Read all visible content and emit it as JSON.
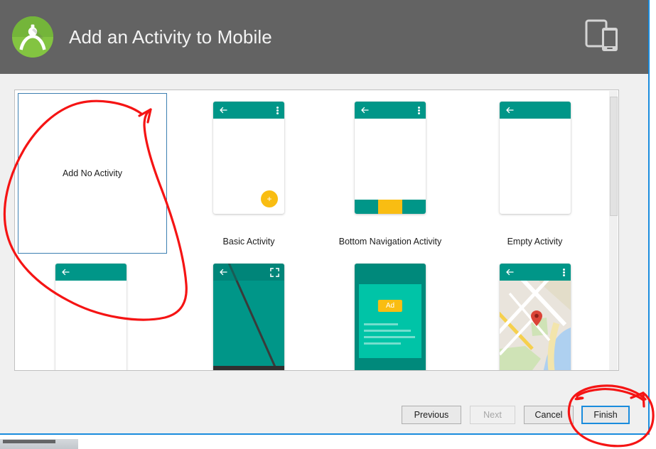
{
  "window": {
    "title": "Add an Activity to Mobile",
    "logo_icon": "android-studio-logo",
    "header_device_icon": "tablet-and-phone-icon"
  },
  "templates": [
    {
      "label": "Add No Activity",
      "kind": "no-activity",
      "selected": true,
      "row": 1,
      "column": 1
    },
    {
      "label": "Basic Activity",
      "kind": "basic",
      "selected": false,
      "row": 1,
      "column": 2,
      "thumb": {
        "toolbar_color": "#009688",
        "back_icon": "arrow-back-icon",
        "overflow_icon": "overflow-menu-icon",
        "fab_icon": "plus-icon",
        "fab_color": "#f9bd12"
      }
    },
    {
      "label": "Bottom Navigation Activity",
      "kind": "bottom-navigation",
      "selected": false,
      "row": 1,
      "column": 3,
      "thumb": {
        "toolbar_color": "#009688",
        "back_icon": "arrow-back-icon",
        "overflow_icon": "overflow-menu-icon",
        "nav_colors": [
          "#009688",
          "#f9bd12",
          "#009688"
        ]
      }
    },
    {
      "label": "Empty Activity",
      "kind": "empty",
      "selected": false,
      "row": 1,
      "column": 4,
      "thumb": {
        "toolbar_color": "#009688",
        "back_icon": "arrow-back-icon"
      }
    },
    {
      "label": "",
      "kind": "plain-toolbar",
      "selected": false,
      "row": 2,
      "column": 1,
      "thumb": {
        "toolbar_color": "#009688",
        "back_icon": "arrow-back-icon"
      }
    },
    {
      "label": "",
      "kind": "fullscreen",
      "selected": false,
      "row": 2,
      "column": 2,
      "thumb": {
        "background_color": "#009688",
        "back_icon": "arrow-back-icon",
        "fullscreen_icon": "fullscreen-icon"
      }
    },
    {
      "label": "",
      "kind": "ad-activity",
      "selected": false,
      "row": 2,
      "column": 3,
      "thumb": {
        "background_color": "#00897b",
        "sheet_color": "#00c4a7",
        "badge_text": "Ad",
        "badge_color": "#f9bd12"
      }
    },
    {
      "label": "",
      "kind": "google-maps-activity",
      "selected": false,
      "row": 2,
      "column": 4,
      "thumb": {
        "toolbar_color": "#009688",
        "back_icon": "arrow-back-icon",
        "overflow_icon": "overflow-menu-icon",
        "map_pin_icon": "map-pin-icon",
        "map_pin_color": "#db4437"
      }
    }
  ],
  "scrollbar": {
    "orientation": "vertical",
    "thumb_position": "top"
  },
  "footer": {
    "buttons": [
      {
        "id": "previous",
        "label": "Previous",
        "enabled": true,
        "focused": false
      },
      {
        "id": "next",
        "label": "Next",
        "enabled": false,
        "focused": false
      },
      {
        "id": "cancel",
        "label": "Cancel",
        "enabled": true,
        "focused": false
      },
      {
        "id": "finish",
        "label": "Finish",
        "enabled": true,
        "focused": true
      }
    ]
  },
  "annotations": {
    "color": "#f51414",
    "marks": [
      {
        "name": "circle-around-add-no-activity",
        "shape": "hand-drawn-loop"
      },
      {
        "name": "circle-around-finish-button",
        "shape": "hand-drawn-loop"
      }
    ]
  },
  "colors": {
    "header_bg": "#636363",
    "dialog_bg": "#f0f0f0",
    "panel_bg": "#ffffff",
    "accent_teal": "#009688",
    "accent_amber": "#f9bd12",
    "selection_blue": "#3c7fb1",
    "focus_blue": "#1a8cdd",
    "annotation_red": "#f51414"
  }
}
